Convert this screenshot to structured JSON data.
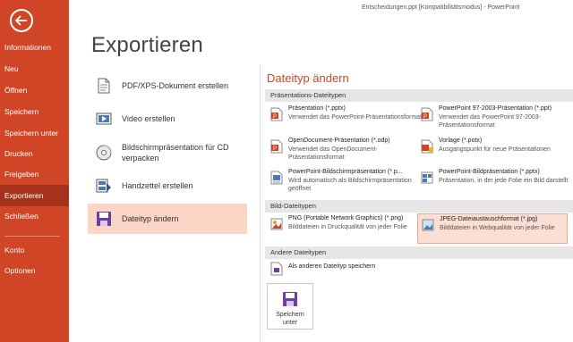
{
  "window": {
    "title": "Entscheidungen.ppt [Kompatibilitätsmodus] - PowerPoint"
  },
  "sidebar": {
    "back_icon": "arrow-left-circle-icon",
    "items": [
      {
        "label": "Informationen"
      },
      {
        "label": "Neu"
      },
      {
        "label": "Öffnen"
      },
      {
        "label": "Speichern"
      },
      {
        "label": "Speichern unter"
      },
      {
        "label": "Drucken"
      },
      {
        "label": "Freigeben"
      },
      {
        "label": "Exportieren"
      },
      {
        "label": "Schließen"
      },
      {
        "label": "Konto"
      },
      {
        "label": "Optionen"
      }
    ],
    "active_item": "Exportieren"
  },
  "page": {
    "title": "Exportieren"
  },
  "options": [
    {
      "label": "PDF/XPS-Dokument erstellen",
      "icon": "pdf-document-icon"
    },
    {
      "label": "Video erstellen",
      "icon": "video-icon"
    },
    {
      "label_line1": "Bildschirmpräsentation für CD",
      "label_line2": "verpacken",
      "icon": "cd-icon"
    },
    {
      "label": "Handzettel erstellen",
      "icon": "handout-icon"
    },
    {
      "label": "Dateityp ändern",
      "icon": "change-filetype-icon",
      "selected": true
    }
  ],
  "filetypes": {
    "title": "Dateityp ändern",
    "groups": [
      {
        "header": "Präsentations-Dateitypen",
        "items": [
          {
            "name": "Präsentation (*.pptx)",
            "desc": "Verwendet das PowerPoint-Präsentationsformat"
          },
          {
            "name": "PowerPoint 97-2003-Präsentation (*.ppt)",
            "desc": "Verwendet das PowerPoint 97-2003-Präsentationsformat"
          },
          {
            "name": "OpenDocument-Präsentation (*.odp)",
            "desc": "Verwendet das OpenDocument-Präsentationsformat"
          },
          {
            "name": "Vorlage (*.potx)",
            "desc": "Ausgangspunkt für neue Präsentationen"
          },
          {
            "name": "PowerPoint-Bildschirmpräsentation (*.p...",
            "desc": "Wird automatisch als Bildschirmpräsentation geöffnet"
          },
          {
            "name": "PowerPoint-Bildpräsentation (*.pptx)",
            "desc": "Präsentation, in der jede Folie ein Bild darstellt"
          }
        ]
      },
      {
        "header": "Bild-Dateitypen",
        "items": [
          {
            "name": "PNG (Portable Network Graphics) (*.png)",
            "desc": "Bilddateien in Druckqualität von jeder Folie"
          },
          {
            "name": "JPEG-Dateiaustauschformat (*.jpg)",
            "desc": "Bilddateien in Webqualität von jeder Folie",
            "selected": true
          }
        ]
      },
      {
        "header": "Andere Dateitypen",
        "items": [
          {
            "name": "Als anderen Dateityp speichern"
          }
        ]
      }
    ]
  },
  "save_button": {
    "line1": "Speichern",
    "line2": "unter",
    "icon": "save-as-icon"
  },
  "colors": {
    "accent": "#d04525",
    "selected": "#fbd5c6",
    "header_bg": "#e6e6e6"
  }
}
